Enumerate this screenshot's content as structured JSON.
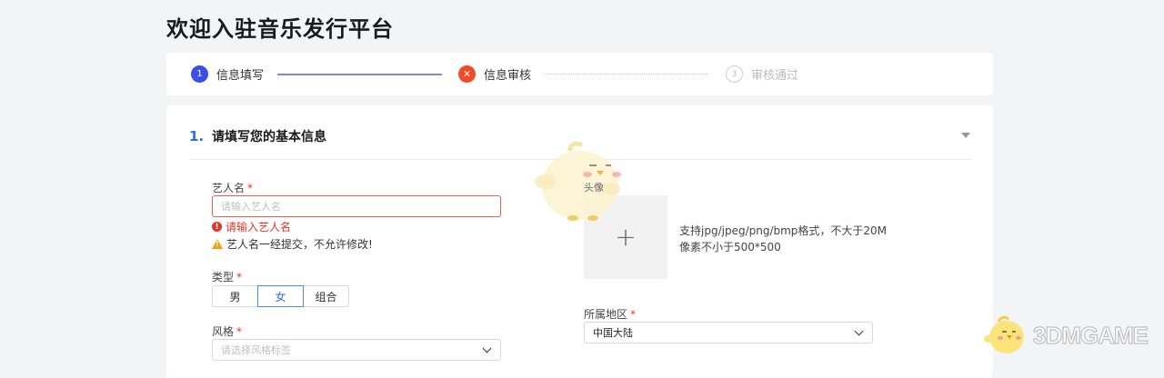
{
  "page_title": "欢迎入驻音乐发行平台",
  "steps": [
    {
      "num": "1",
      "label": "信息填写"
    },
    {
      "num": "✕",
      "label": "信息审核"
    },
    {
      "num": "3",
      "label": "审核通过"
    }
  ],
  "section": {
    "num": "1.",
    "title": "请填写您的基本信息"
  },
  "artist": {
    "label": "艺人名",
    "required": "*",
    "placeholder": "请输入艺人名",
    "error_text": "请输入艺人名",
    "error_icon": "!",
    "warn_text": "艺人名一经提交，不允许修改!",
    "warn_icon": "!"
  },
  "gender": {
    "label": "类型",
    "required": "*",
    "options": [
      "男",
      "女",
      "组合"
    ],
    "selected": "女"
  },
  "style": {
    "label": "风格",
    "required": "*",
    "placeholder": "请选择风格标签"
  },
  "avatar": {
    "label": "头像",
    "plus": "+",
    "hint_line1": "支持jpg/jpeg/png/bmp格式，不大于20M",
    "hint_line2": "像素不小于500*500"
  },
  "region": {
    "label": "所属地区",
    "required": "*",
    "value": "中国大陆"
  },
  "watermark": "3DMGAME",
  "colors": {
    "accent": "#2d6cf0",
    "step_active": "#3b4fe4",
    "error": "#e5352a",
    "warning": "#f39c12"
  }
}
